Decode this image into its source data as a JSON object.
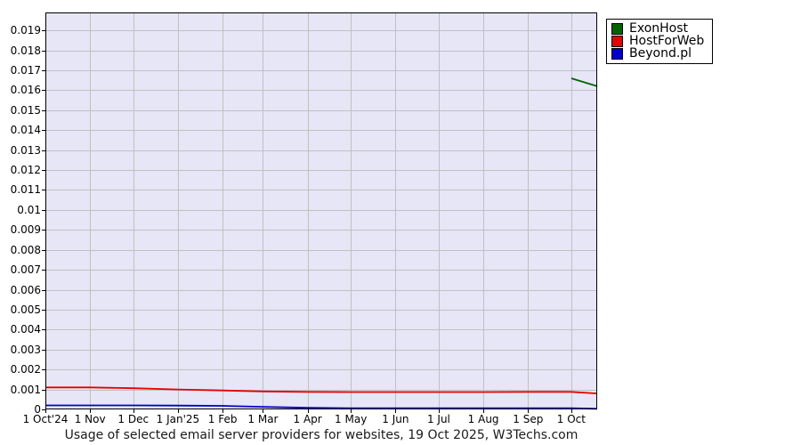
{
  "page": {
    "background": "#ffffff"
  },
  "chart_data": {
    "type": "line",
    "title": "Usage of selected email server providers for websites, 19 Oct 2025, W3Techs.com",
    "source": "W3Techs.com",
    "date_shown": "19 Oct 2025",
    "plot_bg": "#e6e6f7",
    "grid_color": "#c0c0c0",
    "border_color": "#000000",
    "legend_position": "top-right-outside",
    "grid": "both",
    "ylim": [
      0,
      0.0199
    ],
    "ylabel": "",
    "xlabel": "",
    "x_total_days": 383,
    "y_ticks": [
      {
        "value": 0.019,
        "label": "0.019"
      },
      {
        "value": 0.018,
        "label": "0.018"
      },
      {
        "value": 0.017,
        "label": "0.017"
      },
      {
        "value": 0.016,
        "label": "0.016"
      },
      {
        "value": 0.015,
        "label": "0.015"
      },
      {
        "value": 0.014,
        "label": "0.014"
      },
      {
        "value": 0.013,
        "label": "0.013"
      },
      {
        "value": 0.012,
        "label": "0.012"
      },
      {
        "value": 0.011,
        "label": "0.011"
      },
      {
        "value": 0.01,
        "label": "0.01"
      },
      {
        "value": 0.009,
        "label": "0.009"
      },
      {
        "value": 0.008,
        "label": "0.008"
      },
      {
        "value": 0.007,
        "label": "0.007"
      },
      {
        "value": 0.006,
        "label": "0.006"
      },
      {
        "value": 0.005,
        "label": "0.005"
      },
      {
        "value": 0.004,
        "label": "0.004"
      },
      {
        "value": 0.003,
        "label": "0.003"
      },
      {
        "value": 0.002,
        "label": "0.002"
      },
      {
        "value": 0.001,
        "label": "0.001"
      },
      {
        "value": 0,
        "label": "0"
      }
    ],
    "x_ticks": [
      {
        "day": 0,
        "label": "1 Oct'24"
      },
      {
        "day": 31,
        "label": "1 Nov"
      },
      {
        "day": 61,
        "label": "1 Dec"
      },
      {
        "day": 92,
        "label": "1 Jan'25"
      },
      {
        "day": 123,
        "label": "1 Feb"
      },
      {
        "day": 151,
        "label": "1 Mar"
      },
      {
        "day": 182,
        "label": "1 Apr"
      },
      {
        "day": 212,
        "label": "1 May"
      },
      {
        "day": 243,
        "label": "1 Jun"
      },
      {
        "day": 273,
        "label": "1 Jul"
      },
      {
        "day": 304,
        "label": "1 Aug"
      },
      {
        "day": 335,
        "label": "1 Sep"
      },
      {
        "day": 365,
        "label": "1 Oct"
      }
    ],
    "series": [
      {
        "name": "ExonHost",
        "color": "#006400",
        "points": [
          {
            "day": 365,
            "value": 0.0166
          },
          {
            "day": 383,
            "value": 0.0162
          }
        ]
      },
      {
        "name": "HostForWeb",
        "color": "#e60000",
        "points": [
          {
            "day": 0,
            "value": 0.0011
          },
          {
            "day": 31,
            "value": 0.0011
          },
          {
            "day": 61,
            "value": 0.00106
          },
          {
            "day": 92,
            "value": 0.001
          },
          {
            "day": 123,
            "value": 0.00095
          },
          {
            "day": 151,
            "value": 0.0009
          },
          {
            "day": 182,
            "value": 0.00088
          },
          {
            "day": 212,
            "value": 0.00087
          },
          {
            "day": 243,
            "value": 0.00087
          },
          {
            "day": 273,
            "value": 0.00087
          },
          {
            "day": 304,
            "value": 0.00087
          },
          {
            "day": 335,
            "value": 0.00088
          },
          {
            "day": 365,
            "value": 0.00088
          },
          {
            "day": 383,
            "value": 0.0008
          }
        ]
      },
      {
        "name": "Beyond.pl",
        "color": "#0000cc",
        "points": [
          {
            "day": 0,
            "value": 0.0002
          },
          {
            "day": 31,
            "value": 0.0002
          },
          {
            "day": 61,
            "value": 0.0002
          },
          {
            "day": 92,
            "value": 0.00019
          },
          {
            "day": 123,
            "value": 0.00018
          },
          {
            "day": 151,
            "value": 0.00013
          },
          {
            "day": 182,
            "value": 8e-05
          },
          {
            "day": 212,
            "value": 6e-05
          },
          {
            "day": 243,
            "value": 6e-05
          },
          {
            "day": 273,
            "value": 6e-05
          },
          {
            "day": 304,
            "value": 6e-05
          },
          {
            "day": 335,
            "value": 6e-05
          },
          {
            "day": 365,
            "value": 6e-05
          },
          {
            "day": 383,
            "value": 3e-05
          }
        ]
      }
    ]
  }
}
